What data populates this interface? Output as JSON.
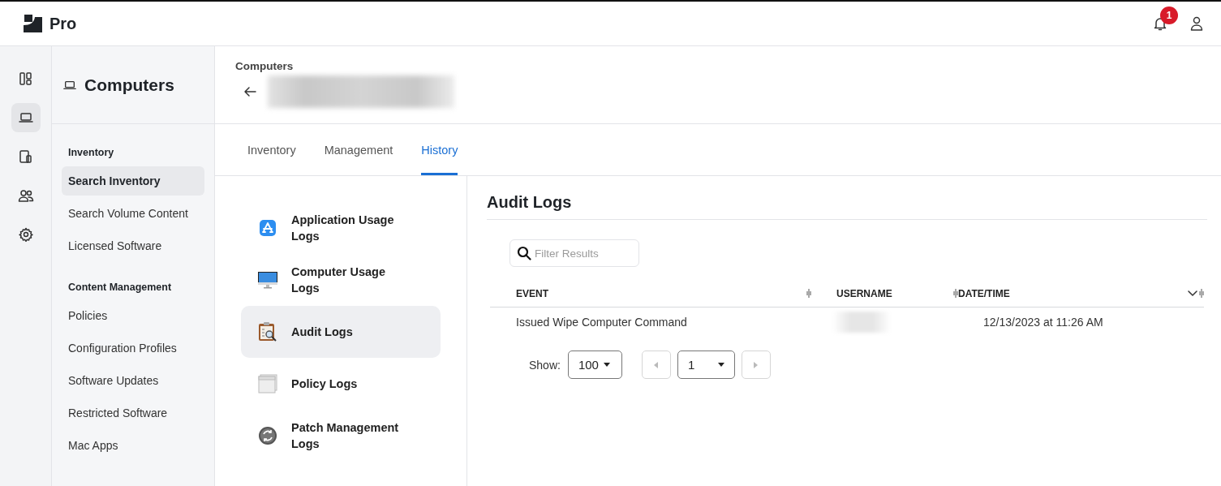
{
  "top_bar": {
    "product": "Pro",
    "notification_count": "1"
  },
  "rail": [
    {
      "kind": "dashboard",
      "selected": false
    },
    {
      "kind": "computer",
      "selected": true
    },
    {
      "kind": "devices",
      "selected": false
    },
    {
      "kind": "users",
      "selected": false
    },
    {
      "kind": "settings",
      "selected": false
    }
  ],
  "sidebar": {
    "title": "Computers",
    "sections": [
      {
        "heading": "Inventory",
        "items": [
          {
            "label": "Search Inventory",
            "selected": true
          },
          {
            "label": "Search Volume Content",
            "selected": false
          },
          {
            "label": "Licensed Software",
            "selected": false
          }
        ]
      },
      {
        "heading": "Content Management",
        "items": [
          {
            "label": "Policies",
            "selected": false
          },
          {
            "label": "Configuration Profiles",
            "selected": false
          },
          {
            "label": "Software Updates",
            "selected": false
          },
          {
            "label": "Restricted Software",
            "selected": false
          },
          {
            "label": "Mac Apps",
            "selected": false
          }
        ]
      }
    ]
  },
  "breadcrumb": "Computers",
  "tabs": [
    {
      "label": "Inventory",
      "selected": false
    },
    {
      "label": "Management",
      "selected": false
    },
    {
      "label": "History",
      "selected": true
    }
  ],
  "history_items": [
    {
      "label": "Application Usage Logs",
      "kind": "app-store",
      "selected": false
    },
    {
      "label": "Computer Usage Logs",
      "kind": "monitor",
      "selected": false
    },
    {
      "label": "Audit Logs",
      "kind": "clipboard",
      "selected": true
    },
    {
      "label": "Policy Logs",
      "kind": "window",
      "selected": false
    },
    {
      "label": "Patch Management Logs",
      "kind": "patch",
      "selected": false
    }
  ],
  "panel": {
    "title": "Audit Logs",
    "filter": {
      "placeholder": "Filter Results"
    },
    "columns": [
      {
        "label": "EVENT",
        "sorted": false
      },
      {
        "label": "USERNAME",
        "sorted": false
      },
      {
        "label": "DATE/TIME",
        "sorted": true
      }
    ],
    "rows": [
      {
        "event": "Issued Wipe Computer Command",
        "date_time": "12/13/2023 at 11:26 AM"
      }
    ],
    "pagination": {
      "show_label": "Show:",
      "page_size": "100",
      "page": "1",
      "previous_disabled": true,
      "next_disabled": true
    }
  }
}
